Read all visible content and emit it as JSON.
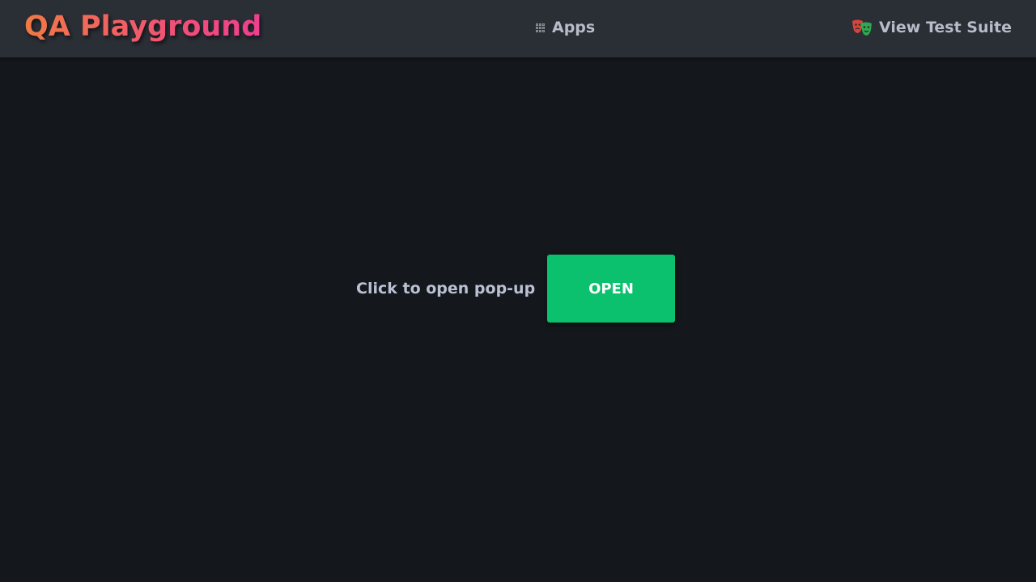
{
  "header": {
    "logo": "QA Playground",
    "apps_icon": "grid-icon",
    "apps_label": "Apps",
    "suite_icon": "theater-masks-icon",
    "suite_label": "View Test Suite"
  },
  "main": {
    "prompt": "Click to open pop-up",
    "open_button_label": "OPEN"
  },
  "colors": {
    "background": "#14181c",
    "header_background": "#2a2e35",
    "logo_gradient_start": "#f07a45",
    "logo_gradient_end": "#ee3f8f",
    "nav_text": "#b7bdc8",
    "prompt_text": "#b9c1d3",
    "button": "#0cc16e",
    "button_text": "#ffffff"
  }
}
